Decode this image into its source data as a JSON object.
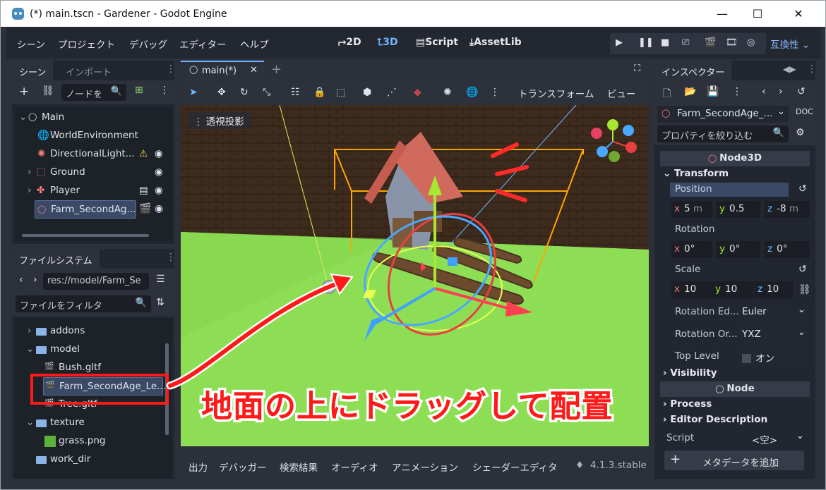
{
  "window": {
    "title": "(*) main.tscn - Gardener - Godot Engine",
    "min": "—",
    "max": "☐",
    "close": "✕"
  },
  "menus": [
    "シーン",
    "プロジェクト",
    "デバッグ",
    "エディター",
    "ヘルプ"
  ],
  "modes": {
    "m2d": "2D",
    "m3d": "3D",
    "script": "Script",
    "assetlib": "AssetLib"
  },
  "compat": "互換性",
  "scene_panel": {
    "tab_scene": "シーン",
    "tab_import": "インポート",
    "filter_placeholder": "ノードを",
    "nodes": [
      {
        "label": "Main"
      },
      {
        "label": "WorldEnvironment"
      },
      {
        "label": "DirectionalLight..."
      },
      {
        "label": "Ground"
      },
      {
        "label": "Player"
      },
      {
        "label": "Farm_SecondAg..."
      }
    ]
  },
  "filesystem": {
    "tab": "ファイルシステム",
    "path": "res://model/Farm_Se",
    "filter_placeholder": "ファイルをフィルタ",
    "items": [
      {
        "label": "addons"
      },
      {
        "label": "model"
      },
      {
        "label": "Bush.gltf"
      },
      {
        "label": "Farm_SecondAge_Le..."
      },
      {
        "label": "Tree.gltf"
      },
      {
        "label": "texture"
      },
      {
        "label": "grass.png"
      },
      {
        "label": "work_dir"
      }
    ]
  },
  "editor": {
    "tab": "main(*)",
    "transform_menu": "トランスフォーム",
    "view_menu": "ビュー",
    "perspective": "透視投影"
  },
  "bottom": {
    "tabs": [
      "出力",
      "デバッガー",
      "検索結果",
      "オーディオ",
      "アニメーション",
      "シェーダーエディタ"
    ],
    "version": "4.1.3.stable"
  },
  "inspector": {
    "tab": "インスペクター",
    "node_name": "Farm_SecondAge_...",
    "filter_placeholder": "プロパティを絞り込む",
    "class_header": "Node3D",
    "transform_section": "Transform",
    "position_label": "Position",
    "position": {
      "x": "5",
      "y": "0.5",
      "z": "-8",
      "unit": "m"
    },
    "rotation_label": "Rotation",
    "rotation": {
      "x": "0",
      "y": "0",
      "z": "0",
      "unit": "°"
    },
    "scale_label": "Scale",
    "scale": {
      "x": "10",
      "y": "10",
      "z": "10"
    },
    "rot_edit_label": "Rotation Ed...",
    "rot_edit_value": "Euler",
    "rot_order_label": "Rotation Or...",
    "rot_order_value": "YXZ",
    "top_level_label": "Top Level",
    "top_level_value": "オン",
    "visibility_section": "Visibility",
    "node_header": "Node",
    "process_section": "Process",
    "editor_desc_section": "Editor Description",
    "script_label": "Script",
    "script_value": "<空>",
    "add_metadata": "メタデータを追加"
  },
  "annotation": {
    "callout": "地面の上にドラッグして配置"
  },
  "colors": {
    "accent": "#70b8ff",
    "annotation_red": "#ff1a1a",
    "selection_orange": "#ffa500"
  }
}
